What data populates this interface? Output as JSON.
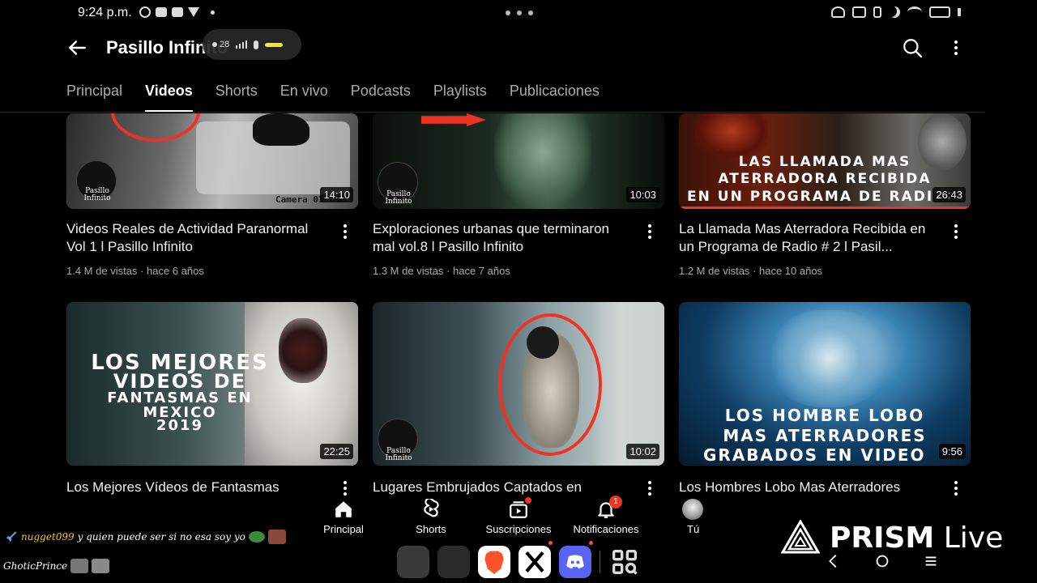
{
  "status_bar": {
    "time": "9:24 p.m."
  },
  "header": {
    "channel_title": "Pasillo Infinito",
    "mic_overlay": {
      "participants": "28"
    }
  },
  "tabs": [
    {
      "label": "Principal",
      "active": false
    },
    {
      "label": "Videos",
      "active": true
    },
    {
      "label": "Shorts",
      "active": false
    },
    {
      "label": "En vivo",
      "active": false
    },
    {
      "label": "Podcasts",
      "active": false
    },
    {
      "label": "Playlists",
      "active": false
    },
    {
      "label": "Publicaciones",
      "active": false
    }
  ],
  "videos": [
    {
      "title": "Videos Reales de Actividad Paranormal Vol 1 l Pasillo Infinito",
      "meta": "1.4 M de vistas · hace 6 años",
      "duration": "14:10",
      "thumb_caption": "Camera 01",
      "logo_text": "Pasillo Infinito"
    },
    {
      "title": "Exploraciones urbanas que terminaron mal vol.8 l Pasillo Infinito",
      "meta": "1.3 M de vistas · hace 7 años",
      "duration": "10:03",
      "logo_text": "Pasillo Infinito"
    },
    {
      "title": "La Llamada Mas Aterradora Recibida en un Programa de Radio # 2 l Pasil...",
      "meta": "1.2 M de vistas · hace 10 años",
      "duration": "26:43",
      "thumb_text": [
        "LAS LLAMADA MAS",
        "ATERRADORA RECIBIDA",
        "EN UN PROGRAMA DE RADI"
      ]
    },
    {
      "title": "Los Mejores Vídeos de Fantasmas",
      "duration": "22:25",
      "thumb_text": [
        "LOS MEJORES",
        "VIDEOS DE",
        "FANTASMAS EN",
        "MEXICO",
        "2019"
      ]
    },
    {
      "title": "Lugares Embrujados Captados en",
      "duration": "10:02",
      "logo_text": "Pasillo Infinito"
    },
    {
      "title": "Los Hombres Lobo Mas Aterradores",
      "duration": "9:56",
      "thumb_text": [
        "LOS HOMBRE LOBO",
        "MAS ATERRADORES",
        "GRABADOS EN VIDEO"
      ]
    }
  ],
  "bottom_nav": [
    {
      "label": "Principal",
      "icon": "home-icon"
    },
    {
      "label": "Shorts",
      "icon": "shorts-icon"
    },
    {
      "label": "Suscripciones",
      "icon": "subscriptions-icon"
    },
    {
      "label": "Notificaciones",
      "icon": "bell-icon",
      "badge": "1"
    },
    {
      "label": "Tú",
      "icon": "avatar-icon"
    }
  ],
  "chat": [
    {
      "user": "nugget099",
      "message": "y quien puede ser si no esa soy yo"
    },
    {
      "user": "GhoticPrince",
      "message": ""
    }
  ],
  "prism": {
    "brand_bold": "PRISM",
    "brand_light": " Live"
  },
  "colors": {
    "accent_red": "#e32222",
    "background": "#000000",
    "text_secondary": "#aaaaaa"
  }
}
